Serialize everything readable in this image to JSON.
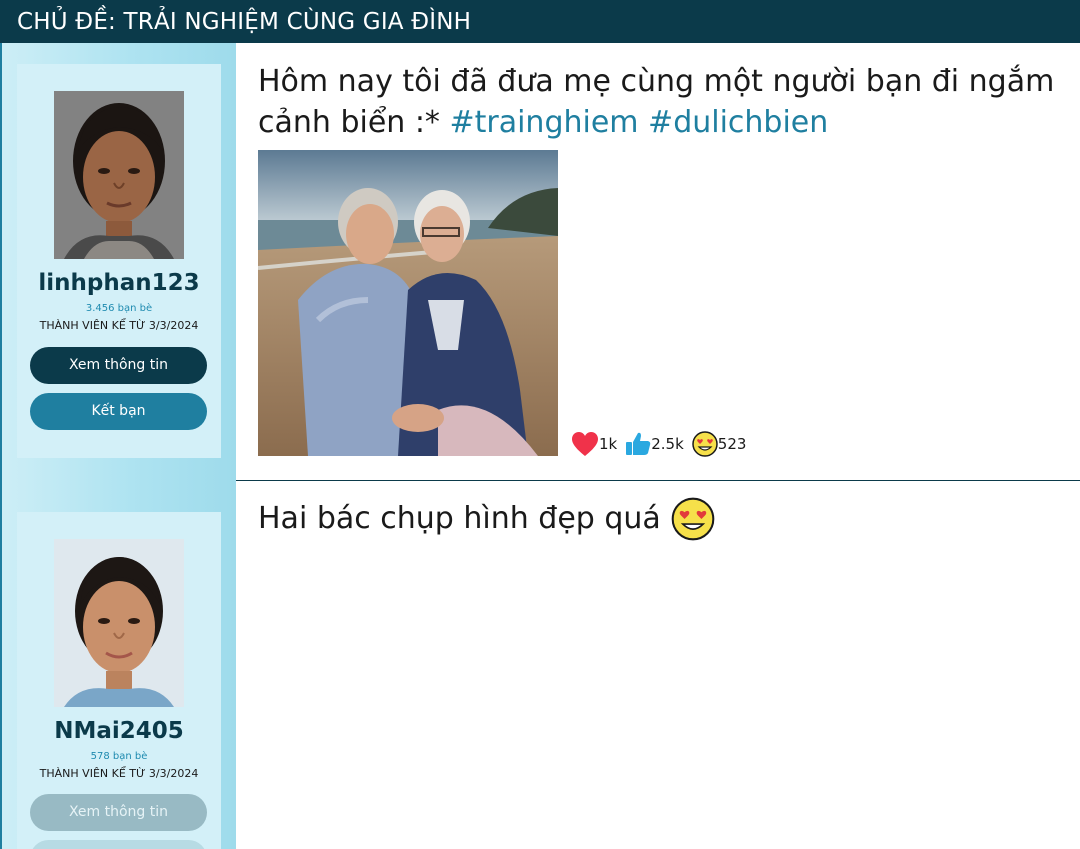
{
  "topic": {
    "title": "CHỦ ĐỀ: TRẢI NGHIỆM CÙNG GIA ĐÌNH"
  },
  "profiles": [
    {
      "username": "linhphan123",
      "friends": "3.456 bạn bè",
      "member_since": "THÀNH VIÊN KỂ TỪ 3/3/2024",
      "view_button": "Xem thông tin",
      "friend_button": "Kết bạn"
    },
    {
      "username": "NMai2405",
      "friends": "578 bạn bè",
      "member_since": "THÀNH VIÊN KỂ TỪ 3/3/2024",
      "view_button": "Xem thông tin"
    }
  ],
  "post": {
    "text": "Hôm nay tôi đã đưa mẹ cùng một người bạn đi ngắm cảnh biển :*",
    "hashtags": "#trainghiem #dulichbien",
    "reactions": [
      {
        "icon": "heart-icon",
        "count": "1k",
        "color": "#f0324a"
      },
      {
        "icon": "thumbs-up-icon",
        "count": "2.5k",
        "color": "#2aa8e0"
      },
      {
        "icon": "heart-eyes-emoji-icon",
        "count": "523",
        "color": "#f6e04a"
      }
    ]
  },
  "comment": {
    "text": "Hai bác chụp hình đẹp quá",
    "emoji": "heart-eyes-emoji-icon"
  },
  "colors": {
    "header": "#0b3a4a",
    "accent": "#1f7fa0",
    "sidebar": "#aee3f1",
    "card": "#d3f0f8"
  }
}
